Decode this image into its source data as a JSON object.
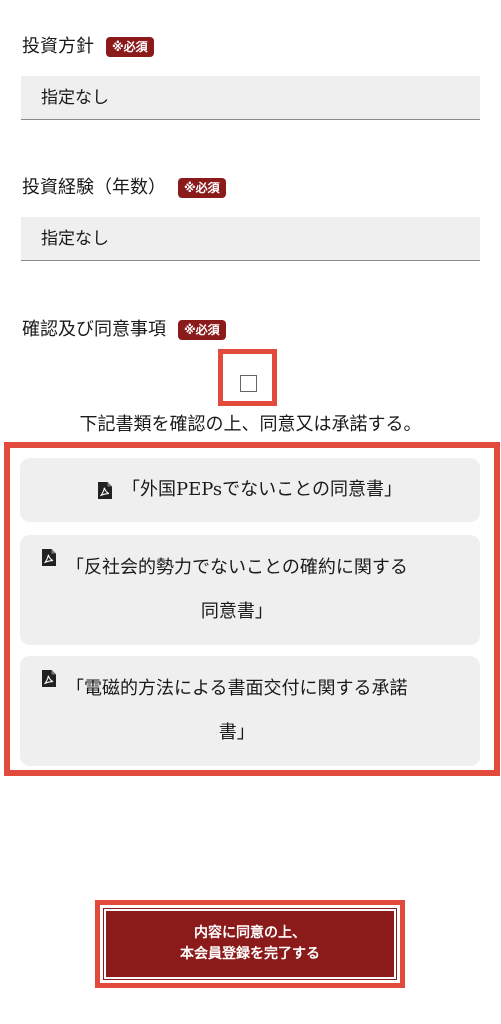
{
  "required_badge": "※必須",
  "investment_policy": {
    "label": "投資方針",
    "value": "指定なし"
  },
  "investment_experience": {
    "label": "投資経験（年数）",
    "value": "指定なし"
  },
  "consent": {
    "label": "確認及び同意事項",
    "checked": false,
    "statement": "下記書類を確認の上、同意又は承諾する。"
  },
  "documents": [
    {
      "line1": "「外国PEPsでないことの同意書」",
      "line2": ""
    },
    {
      "line1": "「反社会的勢力でないことの確約に関する",
      "line2": "同意書」"
    },
    {
      "line1": "「電磁的方法による書面交付に関する承諾",
      "line2": "書」"
    }
  ],
  "icons": {
    "document": "pdf-file-icon"
  },
  "submit": {
    "line1": "内容に同意の上、",
    "line2": "本会員登録を完了する"
  },
  "colors": {
    "accent": "#8b1a1a",
    "highlight": "#e24a3b",
    "field_bg": "#efefef"
  }
}
